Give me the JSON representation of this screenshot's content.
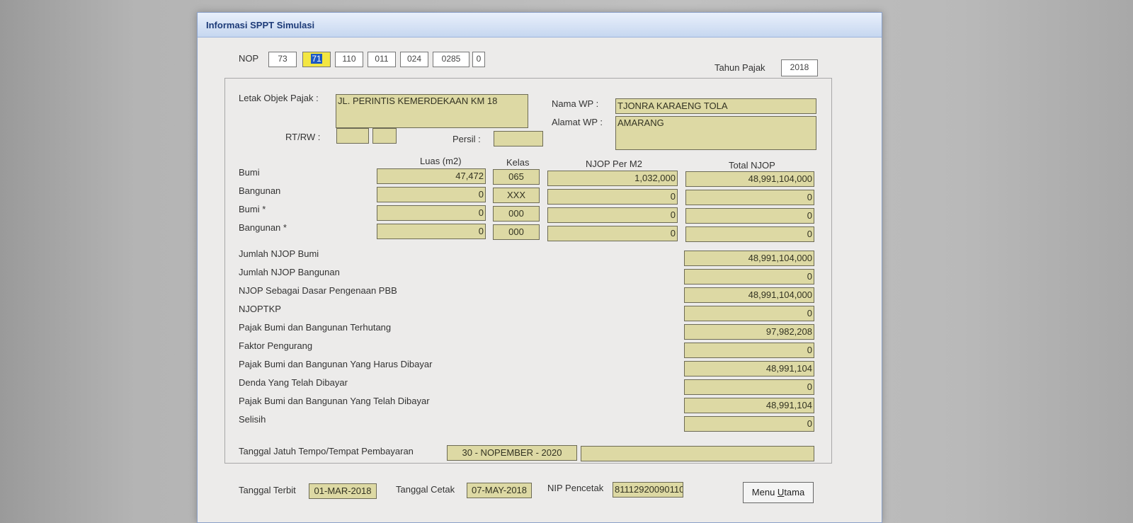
{
  "window": {
    "title": "Informasi SPPT Simulasi"
  },
  "nop": {
    "label": "NOP",
    "segments": [
      "73",
      "71",
      "110",
      "011",
      "024",
      "0285",
      "0"
    ]
  },
  "tahun_pajak": {
    "label": "Tahun Pajak",
    "value": "2018"
  },
  "objek": {
    "letak_label": "Letak Objek Pajak",
    "letak_value": "JL. PERINTIS KEMERDEKAAN KM 18",
    "rtrw_label": "RT/RW",
    "rt_value": "",
    "rw_value": "",
    "persil_label": "Persil",
    "persil_value": ""
  },
  "wp": {
    "nama_label": "Nama WP",
    "nama_value": "TJONRA KARAENG TOLA",
    "alamat_label": "Alamat WP",
    "alamat_value": "AMARANG"
  },
  "njop_table": {
    "headers": {
      "luas": "Luas (m2)",
      "kelas": "Kelas",
      "njop_m2": "NJOP Per M2",
      "total": "Total NJOP"
    },
    "rows": [
      {
        "label": "Bumi",
        "luas": "47,472",
        "kelas": "065",
        "njop_m2": "1,032,000",
        "total": "48,991,104,000"
      },
      {
        "label": "Bangunan",
        "luas": "0",
        "kelas": "XXX",
        "njop_m2": "0",
        "total": "0"
      },
      {
        "label": "Bumi *",
        "luas": "0",
        "kelas": "000",
        "njop_m2": "0",
        "total": "0"
      },
      {
        "label": "Bangunan *",
        "luas": "0",
        "kelas": "000",
        "njop_m2": "0",
        "total": "0"
      }
    ]
  },
  "summary": [
    {
      "label": "Jumlah NJOP Bumi",
      "value": "48,991,104,000"
    },
    {
      "label": "Jumlah NJOP Bangunan",
      "value": "0"
    },
    {
      "label": "NJOP Sebagai Dasar Pengenaan PBB",
      "value": "48,991,104,000"
    },
    {
      "label": "NJOPTKP",
      "value": "0"
    },
    {
      "label": "Pajak Bumi dan Bangunan Terhutang",
      "value": "97,982,208"
    },
    {
      "label": "Faktor Pengurang",
      "value": "0"
    },
    {
      "label": "Pajak Bumi dan Bangunan Yang Harus Dibayar",
      "value": "48,991,104"
    },
    {
      "label": "Denda Yang Telah Dibayar",
      "value": "0"
    },
    {
      "label": "Pajak Bumi dan Bangunan Yang Telah Dibayar",
      "value": "48,991,104"
    },
    {
      "label": "Selisih",
      "value": "0"
    }
  ],
  "jatuh_tempo": {
    "label": "Tanggal Jatuh Tempo/Tempat Pembayaran",
    "date": "30 - NOPEMBER - 2020",
    "tempat": ""
  },
  "footer": {
    "terbit_label": "Tanggal Terbit",
    "terbit_value": "01-MAR-2018",
    "cetak_label": "Tanggal Cetak",
    "cetak_value": "07-MAY-2018",
    "nip_label": "NIP Pencetak",
    "nip_value": "81112920090110",
    "menu_pre": "Menu ",
    "menu_u": "U",
    "menu_post": "tama"
  }
}
